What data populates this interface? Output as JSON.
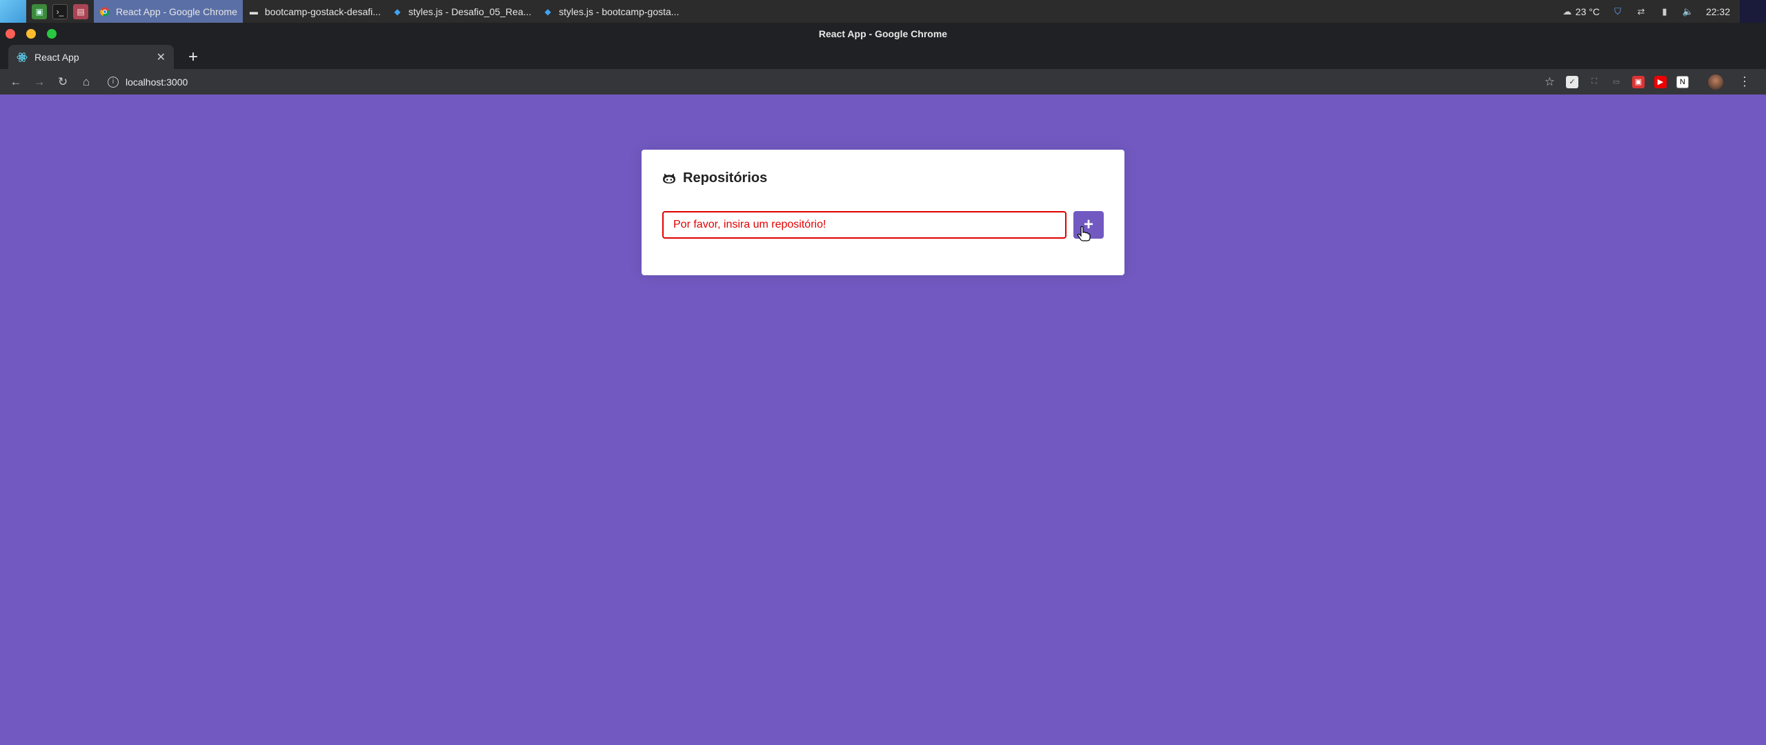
{
  "taskbar": {
    "tasks": [
      {
        "label": "React App - Google Chrome",
        "icon": "chrome-icon",
        "active": true
      },
      {
        "label": "bootcamp-gostack-desafi...",
        "icon": "folder-icon",
        "active": false
      },
      {
        "label": "styles.js - Desafio_05_Rea...",
        "icon": "vscode-icon",
        "active": false
      },
      {
        "label": "styles.js - bootcamp-gosta...",
        "icon": "vscode-icon",
        "active": false
      }
    ],
    "weather": "23 °C",
    "clock": "22:32"
  },
  "window": {
    "title": "React App - Google Chrome"
  },
  "browser": {
    "tab_title": "React App",
    "url": "localhost:3000"
  },
  "app": {
    "heading": "Repositórios",
    "input_value": "Por favor, insira um repositório!",
    "add_label": "+",
    "colors": {
      "primary": "#7159c1",
      "error": "#e20000"
    }
  }
}
